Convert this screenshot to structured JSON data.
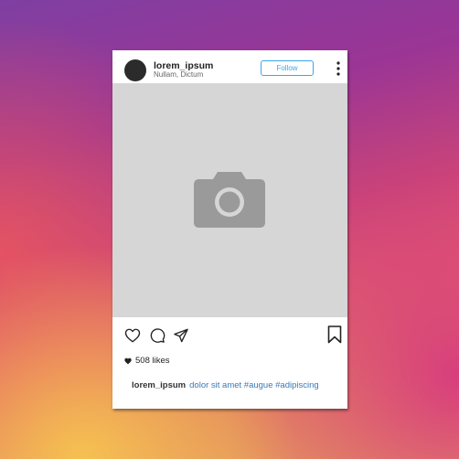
{
  "post": {
    "username": "lorem_ipsum",
    "location": "Nullam, Dictum",
    "follow_label": "Follow",
    "likes_text": "508 likes",
    "caption_user": "lorem_ipsum",
    "caption_text": "dolor sit amet #augue #adipiscing"
  },
  "icons": {
    "avatar": "profile-avatar",
    "more": "more-vertical-icon",
    "photo_placeholder": "camera-icon",
    "like": "heart-icon",
    "comment": "comment-icon",
    "share": "send-icon",
    "save": "bookmark-icon",
    "likes_marker": "heart-filled-icon"
  },
  "colors": {
    "follow_accent": "#3ba6ee",
    "caption_text": "#3a78b8",
    "photo_placeholder": "#d6d6d6",
    "camera": "#9a9a9a"
  }
}
